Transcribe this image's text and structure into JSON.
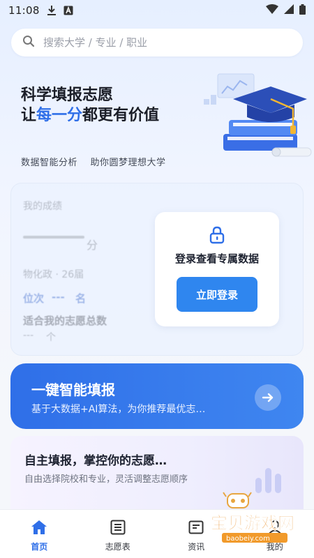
{
  "status_bar": {
    "time": "11:08"
  },
  "search": {
    "placeholder": "搜索大学 / 专业 / 职业"
  },
  "hero": {
    "line1": "科学填报志愿",
    "line2_prefix": "让",
    "line2_accent": "每一分",
    "line2_suffix": "都更有价值",
    "subtitle": "数据智能分析    助你圆梦理想大学"
  },
  "score_card": {
    "title": "我的成绩",
    "score_unit": "分",
    "subjects": "物化政 · 26届",
    "rank_label": "位次",
    "rank_dash": "---",
    "rank_unit": "名",
    "total_label": "适合我的志愿总数",
    "total_dash": "---",
    "total_unit": "个",
    "login_prompt": "登录查看专属数据",
    "login_button": "立即登录"
  },
  "smart_fill": {
    "title": "一键智能填报",
    "subtitle": "基于大数据+AI算法，为你推荐最优志…"
  },
  "self_fill": {
    "title": "自主填报，掌控你的志愿…",
    "subtitle": "自由选择院校和专业，灵活调整志愿顺序"
  },
  "bottom_nav": {
    "items": [
      {
        "label": "首页",
        "icon": "home-icon",
        "active": true
      },
      {
        "label": "志愿表",
        "icon": "list-icon",
        "active": false
      },
      {
        "label": "资讯",
        "icon": "news-icon",
        "active": false
      },
      {
        "label": "我的",
        "icon": "profile-icon",
        "active": false
      }
    ]
  },
  "watermark": {
    "text": "宝贝游戏网",
    "url_text": "baobeiy.com"
  },
  "colors": {
    "accent": "#2f6fe8",
    "button": "#2f86ef"
  }
}
